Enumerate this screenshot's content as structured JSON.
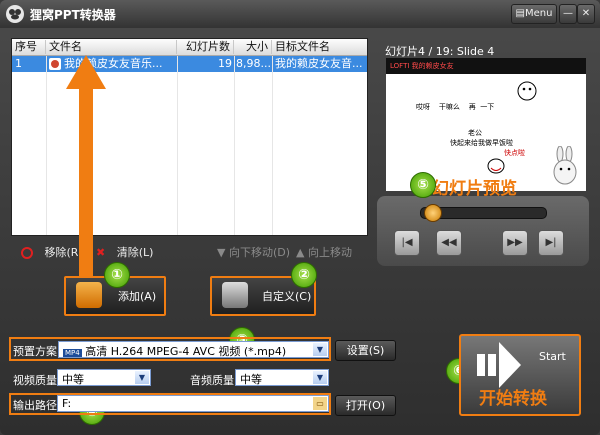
{
  "window": {
    "title": "狸窝PPT转换器",
    "menu_label": "Menu",
    "minimize_label": "—",
    "close_label": "✕"
  },
  "list": {
    "columns": [
      "序号",
      "文件名",
      "幻灯片数",
      "大小",
      "目标文件名"
    ],
    "rows": [
      {
        "index": "1",
        "filename": "我的赖皮女友音乐...",
        "slides": "19",
        "size": "8,98...",
        "target": "我的赖皮女友音..."
      }
    ]
  },
  "list_toolbar": {
    "remove": "移除(R)",
    "clear": "清除(L)",
    "move_down": "向下移动(D)",
    "move_up": "向上移动(U)"
  },
  "preview": {
    "header": "幻灯片4 / 19: Slide 4",
    "caption": "幻灯片预览",
    "slide_logo": "LOFTI 我的赖皮女友",
    "slide_line1": "哎呀    干嘛么    再  一下",
    "slide_line2": "老公",
    "slide_line3": "快起来给我做早饭啦",
    "slide_line4": "快点啦",
    "seek_position": 0.04
  },
  "actions": {
    "add_label": "添加(A)",
    "custom_label": "自定义(C)"
  },
  "form": {
    "preset_label": "预置方案:",
    "preset_value": "高清 H.264 MPEG-4 AVC 视频 (*.mp4)",
    "settings_button": "设置(S)",
    "video_quality_label": "视频质量:",
    "video_quality_value": "中等",
    "audio_quality_label": "音频质量:",
    "audio_quality_value": "中等",
    "output_label": "输出路径:",
    "output_value": "F:",
    "open_button": "打开(O)"
  },
  "start": {
    "small_label": "Start",
    "big_label": "开始转换"
  },
  "step_markers": [
    "①",
    "②",
    "③",
    "④",
    "⑤",
    "⑥"
  ],
  "colors": {
    "accent": "#f07d12",
    "selection": "#3b8ae0",
    "marker": "#4aa800"
  }
}
